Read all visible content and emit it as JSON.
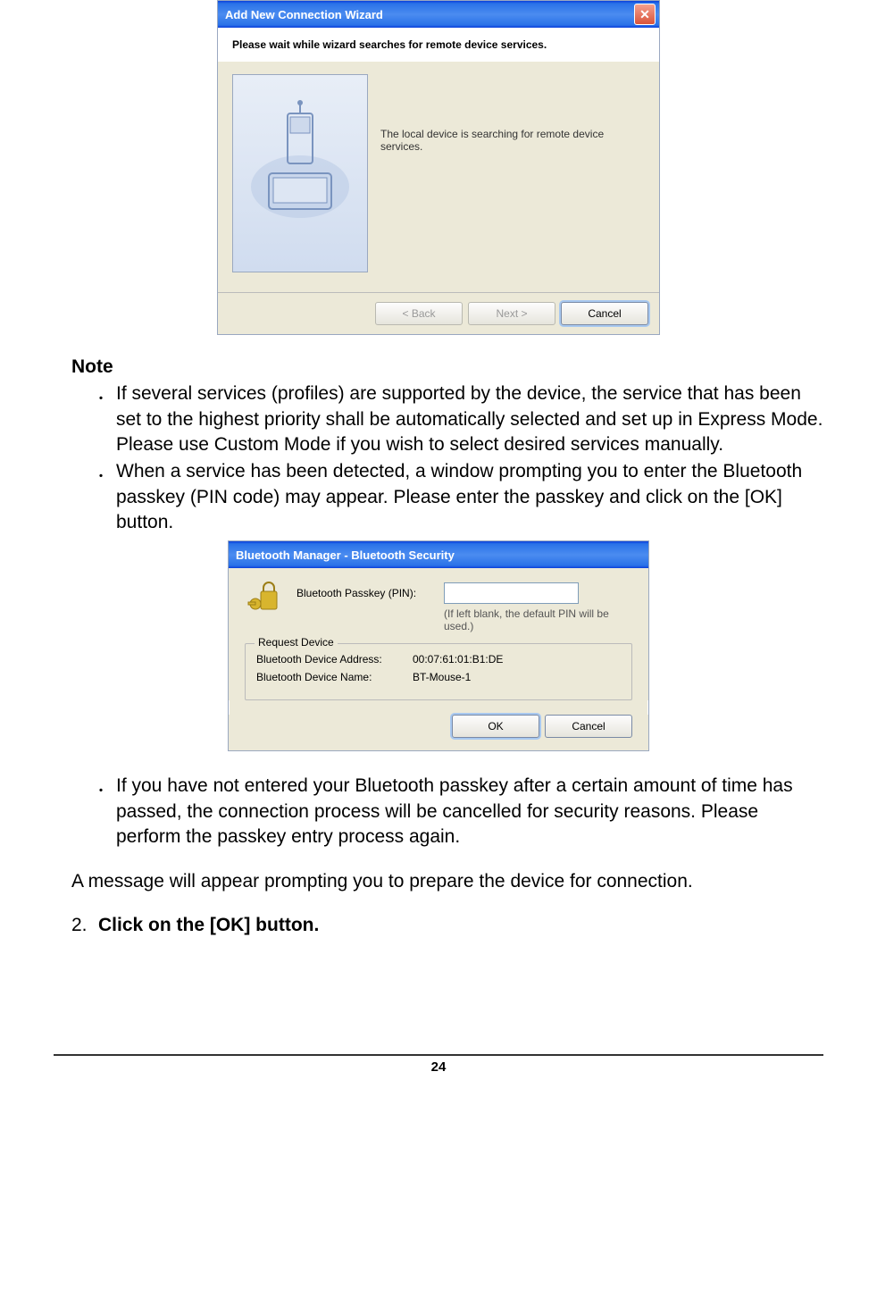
{
  "dialog1": {
    "title": "Add New Connection Wizard",
    "subheader": "Please wait while wizard searches for remote device services.",
    "body_message": "The local device is searching for remote device services.",
    "buttons": {
      "back": "< Back",
      "next": "Next >",
      "cancel": "Cancel"
    }
  },
  "note": {
    "heading": "Note",
    "bullets": [
      "If several services (profiles) are supported by the device, the service that has been set to the highest priority shall be automatically selected and set up in Express Mode. Please use Custom Mode if you wish to select desired services manually.",
      "When a service has been detected, a window prompting you to enter the Bluetooth passkey (PIN code) may appear. Please enter the passkey and click on the [OK] button."
    ],
    "bullet_after": "If you have not entered your Bluetooth passkey after a certain amount of time has passed, the connection process will be cancelled for security reasons. Please perform the passkey entry process again."
  },
  "dialog2": {
    "title": "Bluetooth Manager - Bluetooth Security",
    "pin_label": "Bluetooth Passkey (PIN):",
    "pin_value": "",
    "pin_hint": "(If left blank, the default PIN will be used.)",
    "group_legend": "Request Device",
    "addr_label": "Bluetooth Device Address:",
    "addr_value": "00:07:61:01:B1:DE",
    "name_label": "Bluetooth Device Name:",
    "name_value": "BT-Mouse-1",
    "buttons": {
      "ok": "OK",
      "cancel": "Cancel"
    }
  },
  "between_text": "A message will appear prompting you to prepare the device for connection.",
  "step2": {
    "number": "2.",
    "text": "Click on the [OK] button."
  },
  "page_number": "24"
}
